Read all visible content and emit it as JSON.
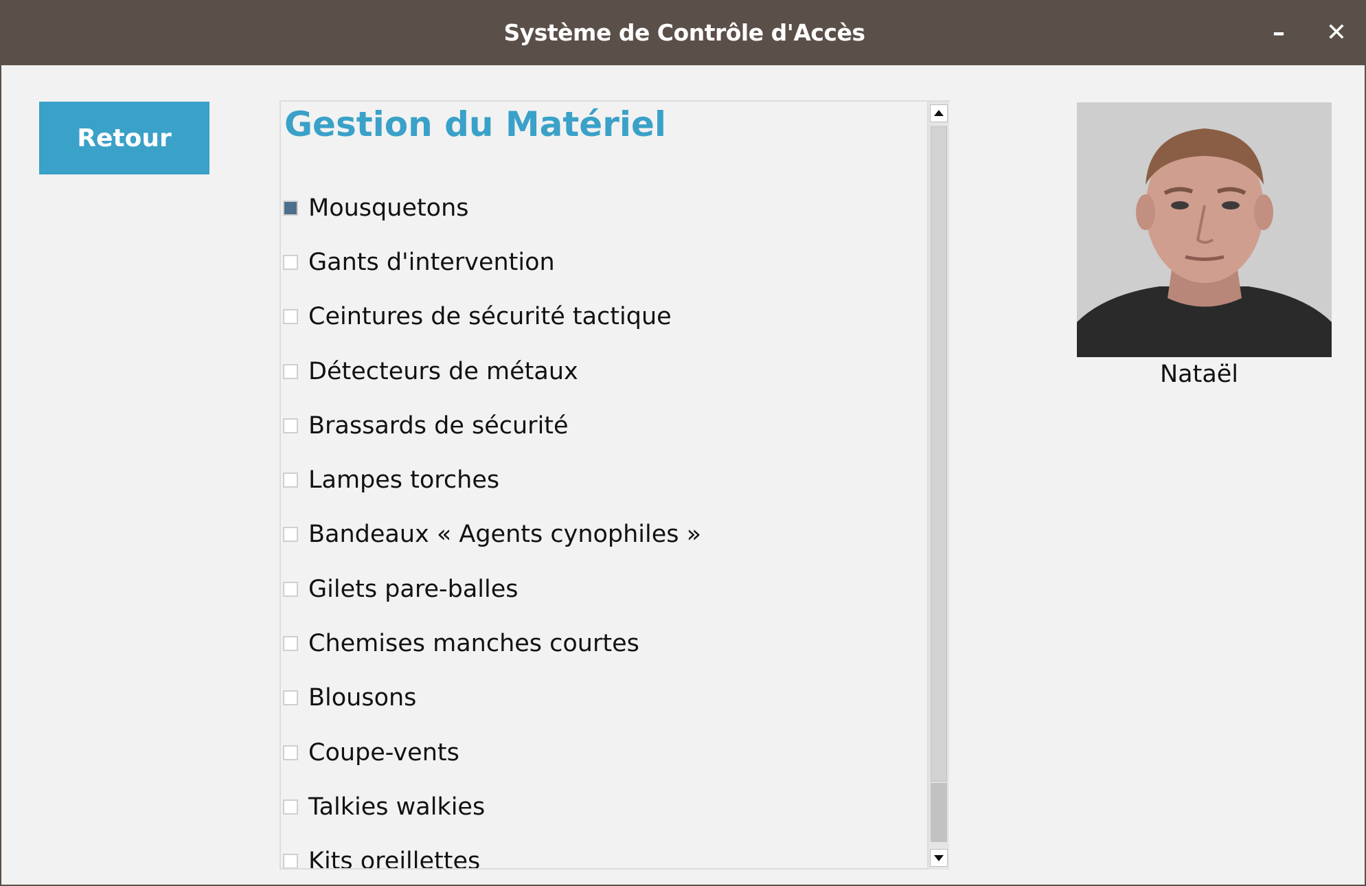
{
  "window": {
    "title": "Système de Contrôle d'Accès",
    "minimize_glyph": "–",
    "close_glyph": "✕"
  },
  "back_button": {
    "label": "Retour"
  },
  "panel": {
    "title": "Gestion du Matériel",
    "items": [
      {
        "label": "Mousquetons",
        "checked": true
      },
      {
        "label": "Gants d'intervention",
        "checked": false
      },
      {
        "label": "Ceintures de sécurité tactique",
        "checked": false
      },
      {
        "label": "Détecteurs de métaux",
        "checked": false
      },
      {
        "label": "Brassards de sécurité",
        "checked": false
      },
      {
        "label": "Lampes torches",
        "checked": false
      },
      {
        "label": "Bandeaux « Agents cynophiles »",
        "checked": false
      },
      {
        "label": "Gilets pare-balles",
        "checked": false
      },
      {
        "label": "Chemises manches courtes",
        "checked": false
      },
      {
        "label": "Blousons",
        "checked": false
      },
      {
        "label": "Coupe-vents",
        "checked": false
      },
      {
        "label": "Talkies walkies",
        "checked": false
      },
      {
        "label": "Kits oreillettes",
        "checked": false
      }
    ]
  },
  "user": {
    "name": "Nataël",
    "photo_icon": "user-photo"
  },
  "colors": {
    "titlebar": "#5b4f49",
    "accent": "#3aa1c8",
    "checkbox_checked": "#4e6f8c",
    "background": "#f2f2f2"
  }
}
